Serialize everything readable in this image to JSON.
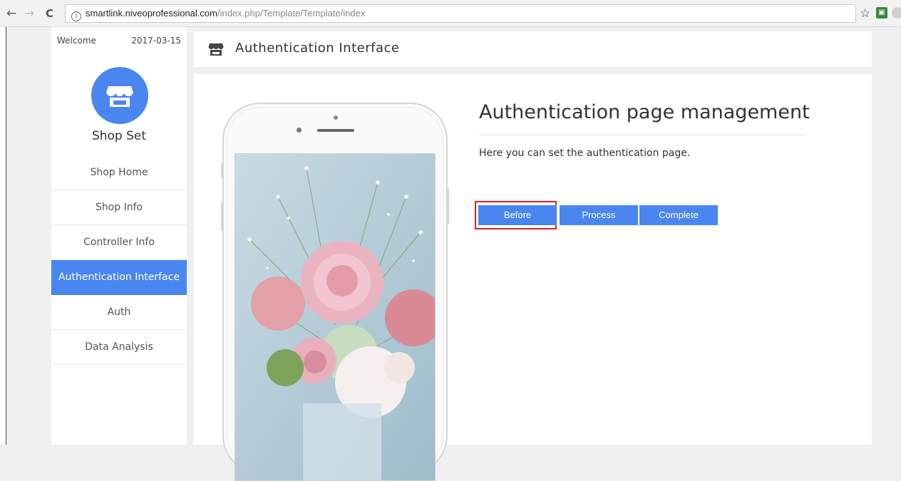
{
  "browser": {
    "back_icon": "←",
    "forward_icon": "→",
    "reload_icon": "C",
    "info_icon": "i",
    "url_domain": "smartlink.niveoprofessional.com",
    "url_path": "/index.php/Template/Template/index",
    "bookmark_icon": "☆"
  },
  "sidebar": {
    "welcome": "Welcome",
    "date": "2017-03-15",
    "shop_title": "Shop Set",
    "items": [
      {
        "label": "Shop Home"
      },
      {
        "label": "Shop Info"
      },
      {
        "label": "Controller Info"
      },
      {
        "label": "Authentication Interface"
      },
      {
        "label": "Auth"
      },
      {
        "label": "Data Analysis"
      }
    ]
  },
  "header": {
    "title": "Authentication Interface"
  },
  "main": {
    "heading": "Authentication page management",
    "description": "Here you can set the authentication page.",
    "buttons": [
      {
        "label": "Before"
      },
      {
        "label": "Process"
      },
      {
        "label": "Complete"
      }
    ]
  },
  "colors": {
    "accent": "#4a86f0",
    "highlight_border": "#e02020"
  }
}
